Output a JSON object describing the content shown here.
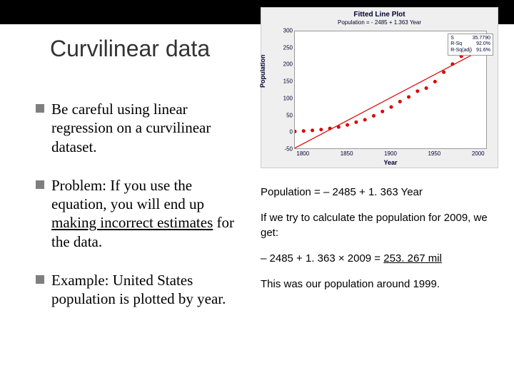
{
  "title": "Curvilinear data",
  "bullets": {
    "b1": "Be careful using linear regression on a curvilinear dataset.",
    "b2a": "Problem: If you use the equation, you will end up ",
    "b2u": "making incorrect estimates",
    "b2b": " for the data.",
    "b3": "Example: United States population is plotted by year."
  },
  "right": {
    "eq": "Population = – 2485 + 1. 363 Year",
    "p1": "If we try to calculate the population for 2009, we get:",
    "p2a": "– 2485 + 1. 363 × 2009 = ",
    "p2u": "253. 267 mil",
    "p3": "This was our population around 1999."
  },
  "chart_data": {
    "type": "scatter",
    "title": "Fitted Line Plot",
    "subtitle": "Population = - 2485 + 1.363 Year",
    "xlabel": "Year",
    "ylabel": "Population",
    "xlim": [
      1790,
      2010
    ],
    "ylim": [
      -50,
      300
    ],
    "xticks": [
      1800,
      1850,
      1900,
      1950,
      2000
    ],
    "yticks": [
      -50,
      0,
      50,
      100,
      150,
      200,
      250,
      300
    ],
    "x": [
      1790,
      1800,
      1810,
      1820,
      1830,
      1840,
      1850,
      1860,
      1870,
      1880,
      1890,
      1900,
      1910,
      1920,
      1930,
      1940,
      1950,
      1960,
      1970,
      1980,
      1990,
      2000
    ],
    "y": [
      3.9,
      5.3,
      7.2,
      9.6,
      12.9,
      17.1,
      23.2,
      31.4,
      38.6,
      50.2,
      63.0,
      76.2,
      92.2,
      106.0,
      123.2,
      132.2,
      151.3,
      179.3,
      203.3,
      226.5,
      248.7,
      281.4
    ],
    "fit_line": {
      "slope": 1.363,
      "intercept": -2485
    },
    "legend": {
      "r1k": "S",
      "r1v": "35.7790",
      "r2k": "R-Sq",
      "r2v": "92.0%",
      "r3k": "R-Sq(adj)",
      "r3v": "91.6%"
    }
  }
}
